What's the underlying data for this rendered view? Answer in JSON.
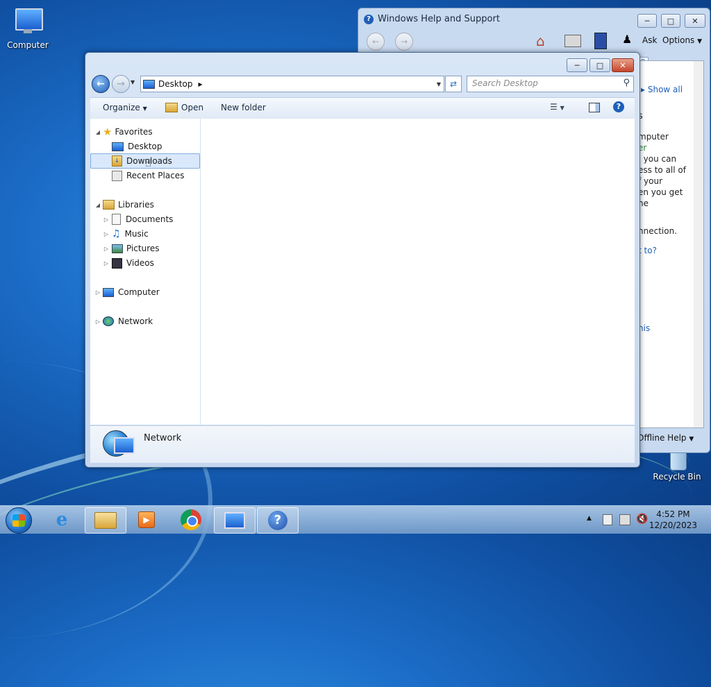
{
  "desktop": {
    "icons": [
      {
        "label": "Computer"
      },
      {
        "label": "Recycle Bin"
      }
    ]
  },
  "help_window": {
    "title": "Windows Help and Support",
    "toolbar": {
      "ask": "Ask",
      "options": "Options"
    },
    "content_fragments": {
      "show_all": "Show all",
      "frag1": "s",
      "frag2": "mputer",
      "frag3": "er",
      "frag4": ", you can",
      "frag5": "ess to all of",
      "frag6": "f your",
      "frag7": "en you get",
      "frag8": "he",
      "frag9": "nnection.",
      "frag10": "t to?",
      "frag11": "his"
    },
    "offline_help": "Offline Help"
  },
  "explorer": {
    "address": {
      "location": "Desktop"
    },
    "search": {
      "placeholder": "Search Desktop"
    },
    "commands": {
      "organize": "Organize",
      "open": "Open",
      "new_folder": "New folder"
    },
    "nav": {
      "favorites": "Favorites",
      "desktop": "Desktop",
      "downloads": "Downloads",
      "recent_places": "Recent Places",
      "libraries": "Libraries",
      "documents": "Documents",
      "music": "Music",
      "pictures": "Pictures",
      "videos": "Videos",
      "computer": "Computer",
      "network": "Network"
    },
    "details": {
      "name": "Network"
    }
  },
  "taskbar": {
    "clock": {
      "time": "4:52 PM",
      "date": "12/20/2023"
    }
  },
  "colors": {
    "accent": "#1f5fb8",
    "selection": "#d9e8fb"
  }
}
